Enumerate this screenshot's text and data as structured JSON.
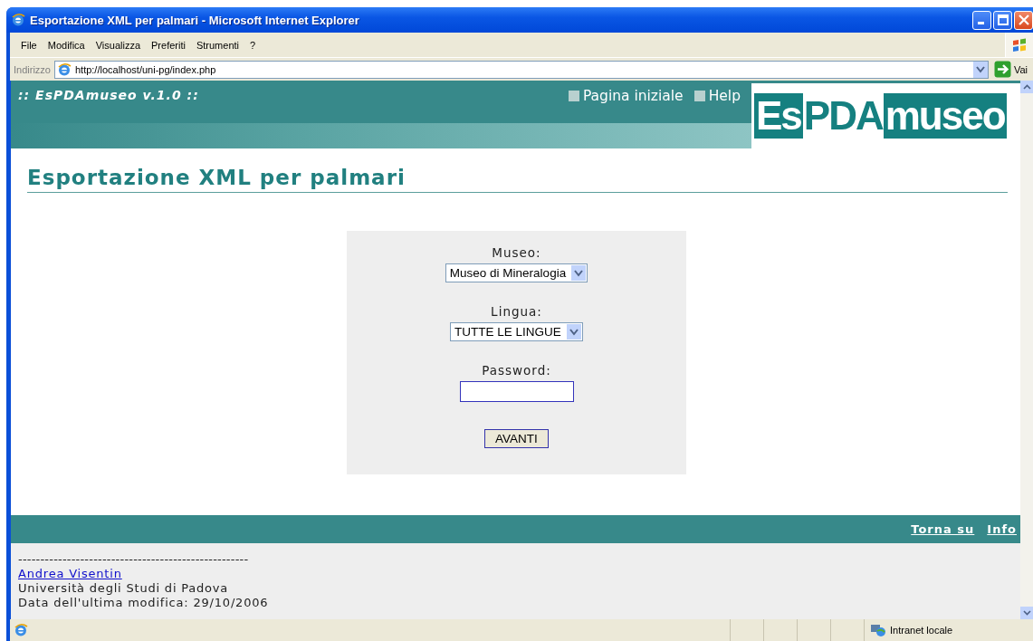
{
  "window": {
    "title": "Esportazione XML per palmari - Microsoft Internet Explorer"
  },
  "menu": [
    "File",
    "Modifica",
    "Visualizza",
    "Preferiti",
    "Strumenti",
    "?"
  ],
  "address_bar": {
    "label": "Indirizzo",
    "url": "http://localhost/uni-pg/index.php",
    "go": "Vai"
  },
  "site_header": {
    "tagline": ":: EsPDAmuseo v.1.0 ::",
    "nav": [
      "Pagina iniziale",
      "Help"
    ],
    "logo": [
      {
        "text": "Es",
        "inverted": true
      },
      {
        "text": "PDA",
        "inverted": false
      },
      {
        "text": "museo",
        "inverted": true
      }
    ]
  },
  "page_title": "Esportazione XML per palmari",
  "form": {
    "fields": [
      {
        "kind": "select",
        "label": "Museo:",
        "value": "Museo di Mineralogia"
      },
      {
        "kind": "select",
        "label": "Lingua:",
        "value": "TUTTE LE LINGUE"
      },
      {
        "kind": "password",
        "label": "Password:"
      }
    ],
    "submit": "AVANTI"
  },
  "footer": {
    "links": [
      "Torna su",
      "Info"
    ],
    "separator": "----------------------------------------------------",
    "author": "Andrea Visentin",
    "lines": [
      "Università degli Studi di Padova",
      "Data dell'ultima modifica: 29/10/2006"
    ]
  },
  "status_bar": {
    "zone": "Intranet locale"
  }
}
